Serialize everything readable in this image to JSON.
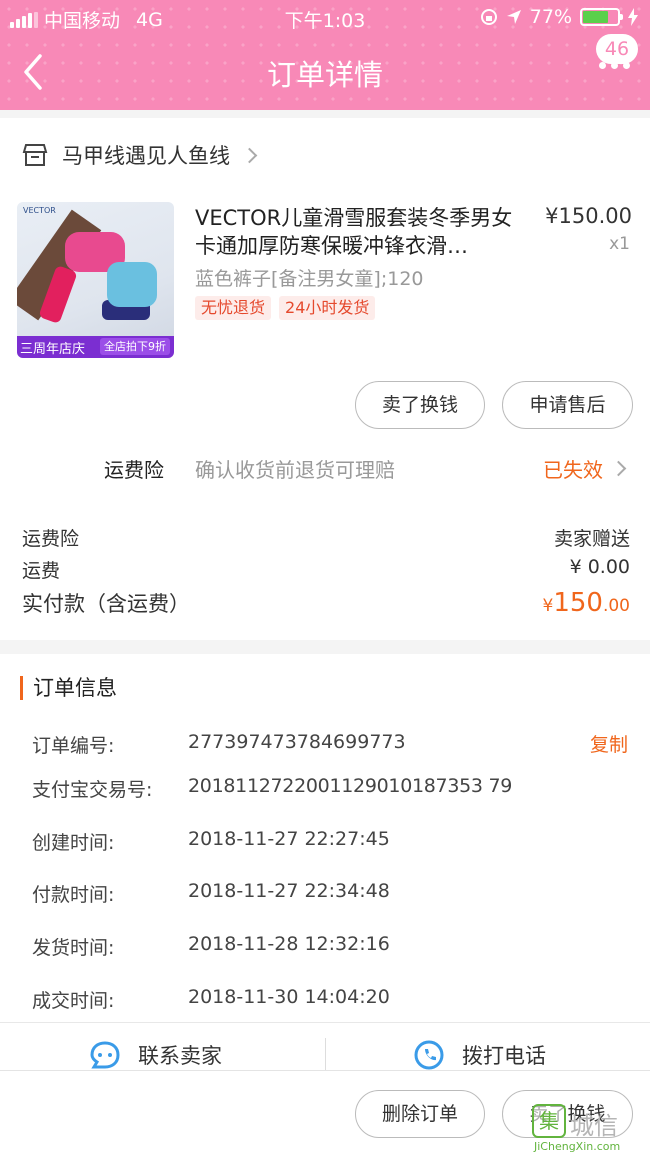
{
  "status_bar": {
    "carrier": "中国移动",
    "network": "4G",
    "time": "下午1:03",
    "battery": "77%"
  },
  "nav": {
    "title": "订单详情",
    "badge": "46"
  },
  "shop": {
    "name": "马甲线遇见人鱼线"
  },
  "product": {
    "title": "VECTOR儿童滑雪服套装冬季男女卡通加厚防寒保暖冲锋衣滑…",
    "price": "¥150.00",
    "qty": "x1",
    "sku": "蓝色裤子[备注男女童];120",
    "tags": [
      "无忧退货",
      "24小时发货"
    ],
    "image_banner_left": "三周年店庆",
    "image_banner_right": "全店拍下9折",
    "image_logo": "VECTOR"
  },
  "actions": {
    "sell": "卖了换钱",
    "after_sale": "申请售后"
  },
  "insurance": {
    "label": "运费险",
    "desc": "确认收货前退货可理赔",
    "status": "已失效"
  },
  "summary": {
    "rows": [
      {
        "label": "运费险",
        "value": "卖家赠送"
      },
      {
        "label": "运费",
        "value": "¥ 0.00"
      }
    ],
    "total_label": "实付款（含运费）",
    "total_currency": "¥",
    "total_int": "150",
    "total_dec": ".00"
  },
  "order_info": {
    "title": "订单信息",
    "copy": "复制",
    "rows": [
      {
        "label": "订单编号:",
        "value": "277397473784699773"
      },
      {
        "label": "支付宝交易号:",
        "value": "2018112722001129010187353 79"
      },
      {
        "label": "创建时间:",
        "value": "2018-11-27 22:27:45"
      },
      {
        "label": "付款时间:",
        "value": "2018-11-27 22:34:48"
      },
      {
        "label": "发货时间:",
        "value": "2018-11-28 12:32:16"
      },
      {
        "label": "成交时间:",
        "value": "2018-11-30 14:04:20"
      }
    ]
  },
  "contact": {
    "seller": "联系卖家",
    "phone": "拨打电话"
  },
  "bottom": {
    "delete": "删除订单",
    "sell": "卖了换钱"
  },
  "watermark": {
    "char": "集",
    "text": "城信",
    "url": "JiChengXin.com"
  },
  "colors": {
    "header": "#f889b7",
    "accent": "#f0661c",
    "tag_bg": "#fdecea"
  }
}
